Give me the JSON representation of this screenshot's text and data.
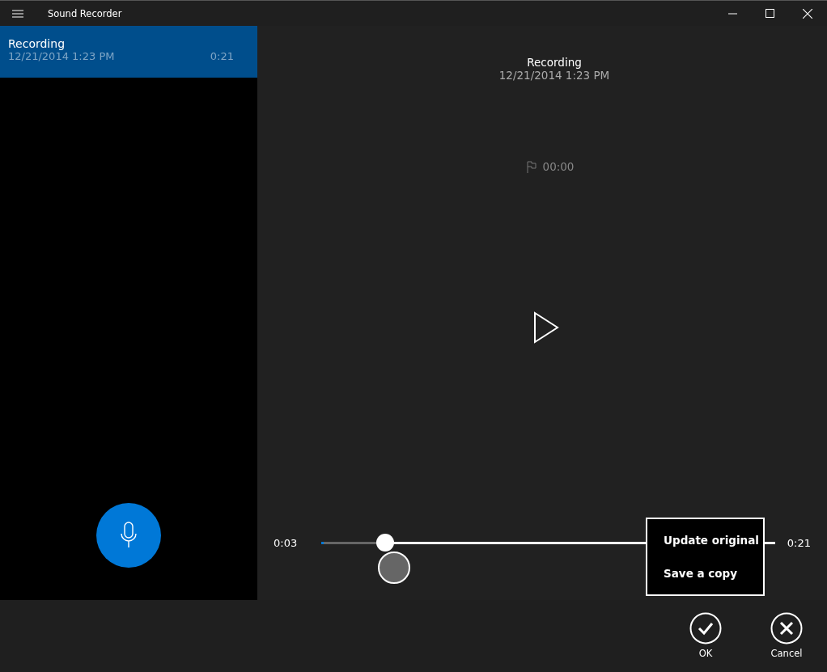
{
  "window": {
    "title": "Sound Recorder"
  },
  "recordings": [
    {
      "name": "Recording",
      "date": "12/21/2014 1:23 PM",
      "duration": "0:21",
      "selected": true
    }
  ],
  "detail": {
    "title": "Recording",
    "date": "12/21/2014 1:23 PM",
    "marker_time": "00:00"
  },
  "trim": {
    "start_time": "0:03",
    "end_time": "0:21",
    "level": 0.14
  },
  "save_menu": {
    "items": [
      "Update original",
      "Save a copy"
    ]
  },
  "actions": [
    {
      "kind": "ok",
      "label": "OK"
    },
    {
      "kind": "cancel",
      "label": "Cancel"
    }
  ]
}
